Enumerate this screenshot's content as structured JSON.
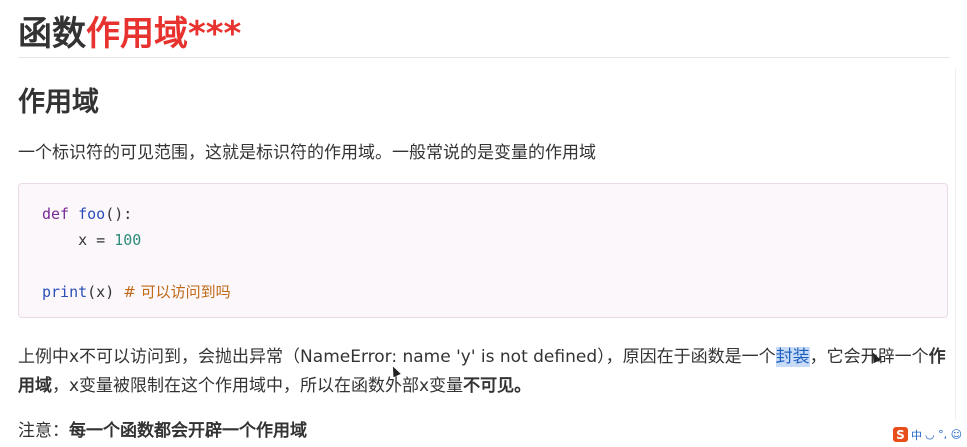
{
  "title": {
    "prefix": "函数",
    "highlight": "作用域",
    "suffix": "***"
  },
  "section_heading": "作用域",
  "intro": "一个标识符的可见范围，这就是标识符的作用域。一般常说的是变量的作用域",
  "code": {
    "line1_kw": "def",
    "line1_fn": "foo",
    "line1_rest": "():",
    "line2_pre": "    x = ",
    "line2_num": "100",
    "line4_fn": "print",
    "line4_rest": "(x) ",
    "line4_comment": "# 可以访问到吗"
  },
  "explain": {
    "part1": "上例中x不可以访问到，会抛出异常（NameError: name 'y' is not defined），原因在于函数是一个",
    "highlight": "封装",
    "part2": "，它会开辟一个",
    "bold1": "作用域",
    "part3": "，x变量被限制在这个作用域中，所以在函数外部x变量",
    "bold2": "不可见。"
  },
  "note": {
    "label": "注意：",
    "text": "每一个函数都会开辟一个作用域"
  },
  "ime": {
    "logo": "S",
    "mode": "中",
    "icons": "◡ °, ☺"
  }
}
